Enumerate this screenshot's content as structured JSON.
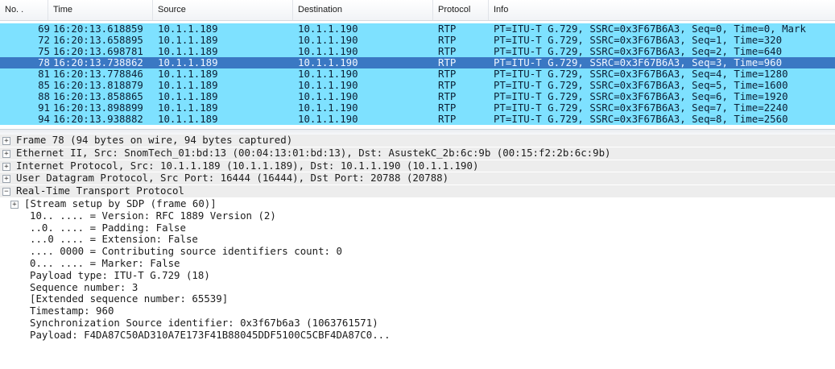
{
  "columns": {
    "no": "No. .",
    "time": "Time",
    "source": "Source",
    "destination": "Destination",
    "protocol": "Protocol",
    "info": "Info"
  },
  "packets": [
    {
      "no": "69",
      "time": "16:20:13.618859",
      "source": "10.1.1.189",
      "destination": "10.1.1.190",
      "protocol": "RTP",
      "info": "PT=ITU-T G.729, SSRC=0x3F67B6A3, Seq=0, Time=0, Mark"
    },
    {
      "no": "72",
      "time": "16:20:13.658895",
      "source": "10.1.1.189",
      "destination": "10.1.1.190",
      "protocol": "RTP",
      "info": "PT=ITU-T G.729, SSRC=0x3F67B6A3, Seq=1, Time=320"
    },
    {
      "no": "75",
      "time": "16:20:13.698781",
      "source": "10.1.1.189",
      "destination": "10.1.1.190",
      "protocol": "RTP",
      "info": "PT=ITU-T G.729, SSRC=0x3F67B6A3, Seq=2, Time=640"
    },
    {
      "no": "78",
      "time": "16:20:13.738862",
      "source": "10.1.1.189",
      "destination": "10.1.1.190",
      "protocol": "RTP",
      "info": "PT=ITU-T G.729, SSRC=0x3F67B6A3, Seq=3, Time=960"
    },
    {
      "no": "81",
      "time": "16:20:13.778846",
      "source": "10.1.1.189",
      "destination": "10.1.1.190",
      "protocol": "RTP",
      "info": "PT=ITU-T G.729, SSRC=0x3F67B6A3, Seq=4, Time=1280"
    },
    {
      "no": "85",
      "time": "16:20:13.818879",
      "source": "10.1.1.189",
      "destination": "10.1.1.190",
      "protocol": "RTP",
      "info": "PT=ITU-T G.729, SSRC=0x3F67B6A3, Seq=5, Time=1600"
    },
    {
      "no": "88",
      "time": "16:20:13.858865",
      "source": "10.1.1.189",
      "destination": "10.1.1.190",
      "protocol": "RTP",
      "info": "PT=ITU-T G.729, SSRC=0x3F67B6A3, Seq=6, Time=1920"
    },
    {
      "no": "91",
      "time": "16:20:13.898899",
      "source": "10.1.1.189",
      "destination": "10.1.1.190",
      "protocol": "RTP",
      "info": "PT=ITU-T G.729, SSRC=0x3F67B6A3, Seq=7, Time=2240"
    },
    {
      "no": "94",
      "time": "16:20:13.938882",
      "source": "10.1.1.189",
      "destination": "10.1.1.190",
      "protocol": "RTP",
      "info": "PT=ITU-T G.729, SSRC=0x3F67B6A3, Seq=8, Time=2560"
    }
  ],
  "selected_packet_no": "78",
  "colors": {
    "rtp_row": "#7ee1ff",
    "selected_row": "#3a78c3",
    "tree_header_bg": "#ededed"
  },
  "details": [
    {
      "text": "Frame 78 (94 bytes on wire, 94 bytes captured)",
      "toggle": "plus-icon"
    },
    {
      "text": "Ethernet II, Src: SnomTech_01:bd:13 (00:04:13:01:bd:13), Dst: AsustekC_2b:6c:9b (00:15:f2:2b:6c:9b)",
      "toggle": "plus-icon"
    },
    {
      "text": "Internet Protocol, Src: 10.1.1.189 (10.1.1.189), Dst: 10.1.1.190 (10.1.1.190)",
      "toggle": "plus-icon"
    },
    {
      "text": "User Datagram Protocol, Src Port: 16444 (16444), Dst Port: 20788 (20788)",
      "toggle": "plus-icon"
    },
    {
      "text": "Real-Time Transport Protocol",
      "toggle": "minus-icon"
    }
  ],
  "rtp_fields": [
    {
      "text": "[Stream setup by SDP (frame 60)]",
      "toggle": "plus-icon"
    },
    {
      "text": "10.. .... = Version: RFC 1889 Version (2)"
    },
    {
      "text": "..0. .... = Padding: False"
    },
    {
      "text": "...0 .... = Extension: False"
    },
    {
      "text": ".... 0000 = Contributing source identifiers count: 0"
    },
    {
      "text": "0... .... = Marker: False"
    },
    {
      "text": "Payload type: ITU-T G.729 (18)"
    },
    {
      "text": "Sequence number: 3"
    },
    {
      "text": "[Extended sequence number: 65539]"
    },
    {
      "text": "Timestamp: 960"
    },
    {
      "text": "Synchronization Source identifier: 0x3f67b6a3 (1063761571)"
    },
    {
      "text": "Payload: F4DA87C50AD310A7E173F41B88045DDF5100C5CBF4DA87C0..."
    }
  ]
}
